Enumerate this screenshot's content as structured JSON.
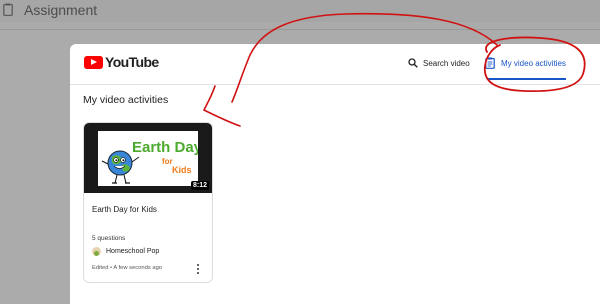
{
  "top_bar": {
    "title": "Assignment"
  },
  "header": {
    "logo_text": "YouTube",
    "search_label": "Search video",
    "activities_tab_label": "My video activities"
  },
  "section": {
    "title": "My video activities"
  },
  "cards": [
    {
      "thumbnail_text_1": "Earth Day",
      "thumbnail_text_2": "for",
      "thumbnail_text_3": "Kids",
      "duration": "8:12",
      "title": "Earth Day for Kids",
      "question_count": "5 questions",
      "channel": "Homeschool Pop",
      "edited": "Edited • A few seconds ago"
    }
  ],
  "colors": {
    "brand_red": "#ff0000",
    "accent_blue": "#1a55c8",
    "annotation_red": "#d11212"
  }
}
